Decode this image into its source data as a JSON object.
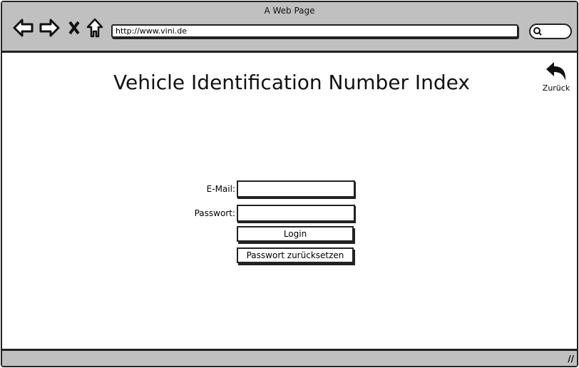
{
  "browser": {
    "title": "A Web Page",
    "url": "http://www.vini.de",
    "icons": [
      "back-arrow-icon",
      "forward-arrow-icon",
      "close-icon",
      "home-icon",
      "search-icon"
    ]
  },
  "page": {
    "heading": "Vehicle Identification Number Index",
    "back_label": "Zurück",
    "email_label": "E-Mail:",
    "password_label": "Passwort:",
    "email_value": "",
    "password_value": "",
    "login_label": "Login",
    "reset_label": "Passwort zurücksetzen"
  }
}
